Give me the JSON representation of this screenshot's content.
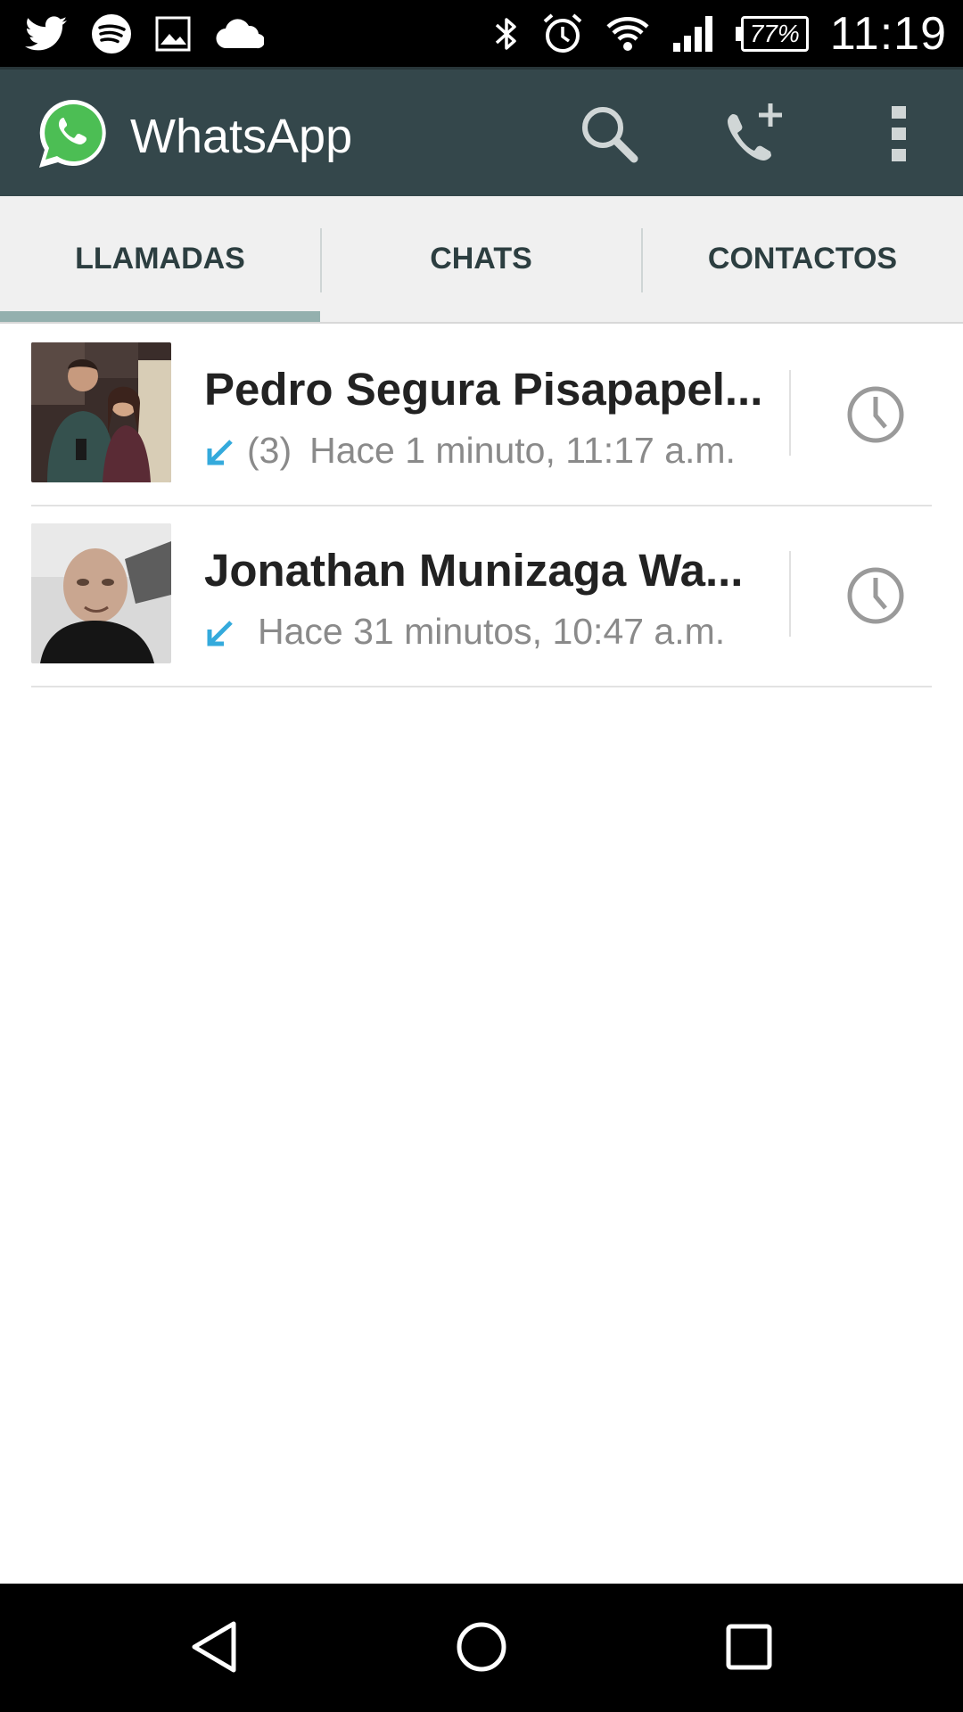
{
  "status_bar": {
    "left_icons": [
      "twitter-icon",
      "spotify-icon",
      "gallery-icon",
      "cloud-icon"
    ],
    "right_icons": [
      "bluetooth-icon",
      "alarm-icon",
      "wifi-icon",
      "signal-icon"
    ],
    "battery": "77%",
    "time": "11:19"
  },
  "app_bar": {
    "title": "WhatsApp",
    "actions": [
      "search-icon",
      "new-call-icon",
      "overflow-menu-icon"
    ]
  },
  "tabs": [
    {
      "label": "LLAMADAS",
      "selected": true
    },
    {
      "label": "CHATS",
      "selected": false
    },
    {
      "label": "CONTACTOS",
      "selected": false
    }
  ],
  "calls": [
    {
      "name": "Pedro Segura Pisapapel...",
      "direction": "incoming",
      "count": "(3)",
      "time": "Hace 1 minuto, 11:17 a.m."
    },
    {
      "name": "Jonathan Munizaga Wa...",
      "direction": "incoming",
      "count": "",
      "time": "Hace 31 minutos, 10:47 a.m."
    }
  ],
  "colors": {
    "app_bar": "#34474b",
    "tab_bar": "#f0f0f0",
    "tab_indicator": "#94b0ae",
    "incoming_arrow": "#34aadc",
    "whatsapp_green": "#4cbe54"
  },
  "nav_bar": {
    "buttons": [
      "back-icon",
      "home-icon",
      "recents-icon"
    ]
  }
}
